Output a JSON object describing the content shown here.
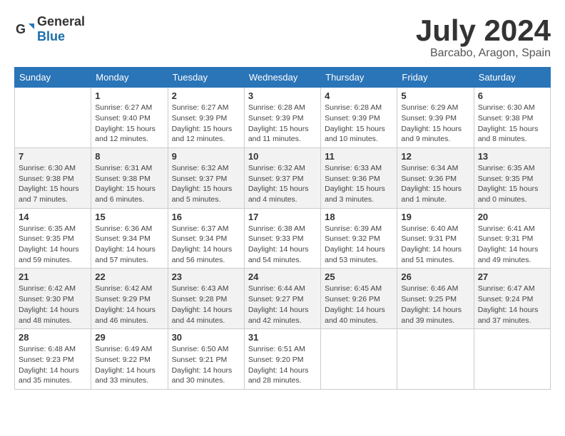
{
  "logo": {
    "text_general": "General",
    "text_blue": "Blue"
  },
  "header": {
    "title": "July 2024",
    "subtitle": "Barcabo, Aragon, Spain"
  },
  "weekdays": [
    "Sunday",
    "Monday",
    "Tuesday",
    "Wednesday",
    "Thursday",
    "Friday",
    "Saturday"
  ],
  "weeks": [
    [
      {
        "day": "",
        "info": ""
      },
      {
        "day": "1",
        "info": "Sunrise: 6:27 AM\nSunset: 9:40 PM\nDaylight: 15 hours\nand 12 minutes."
      },
      {
        "day": "2",
        "info": "Sunrise: 6:27 AM\nSunset: 9:39 PM\nDaylight: 15 hours\nand 12 minutes."
      },
      {
        "day": "3",
        "info": "Sunrise: 6:28 AM\nSunset: 9:39 PM\nDaylight: 15 hours\nand 11 minutes."
      },
      {
        "day": "4",
        "info": "Sunrise: 6:28 AM\nSunset: 9:39 PM\nDaylight: 15 hours\nand 10 minutes."
      },
      {
        "day": "5",
        "info": "Sunrise: 6:29 AM\nSunset: 9:39 PM\nDaylight: 15 hours\nand 9 minutes."
      },
      {
        "day": "6",
        "info": "Sunrise: 6:30 AM\nSunset: 9:38 PM\nDaylight: 15 hours\nand 8 minutes."
      }
    ],
    [
      {
        "day": "7",
        "info": "Sunrise: 6:30 AM\nSunset: 9:38 PM\nDaylight: 15 hours\nand 7 minutes."
      },
      {
        "day": "8",
        "info": "Sunrise: 6:31 AM\nSunset: 9:38 PM\nDaylight: 15 hours\nand 6 minutes."
      },
      {
        "day": "9",
        "info": "Sunrise: 6:32 AM\nSunset: 9:37 PM\nDaylight: 15 hours\nand 5 minutes."
      },
      {
        "day": "10",
        "info": "Sunrise: 6:32 AM\nSunset: 9:37 PM\nDaylight: 15 hours\nand 4 minutes."
      },
      {
        "day": "11",
        "info": "Sunrise: 6:33 AM\nSunset: 9:36 PM\nDaylight: 15 hours\nand 3 minutes."
      },
      {
        "day": "12",
        "info": "Sunrise: 6:34 AM\nSunset: 9:36 PM\nDaylight: 15 hours\nand 1 minute."
      },
      {
        "day": "13",
        "info": "Sunrise: 6:35 AM\nSunset: 9:35 PM\nDaylight: 15 hours\nand 0 minutes."
      }
    ],
    [
      {
        "day": "14",
        "info": "Sunrise: 6:35 AM\nSunset: 9:35 PM\nDaylight: 14 hours\nand 59 minutes."
      },
      {
        "day": "15",
        "info": "Sunrise: 6:36 AM\nSunset: 9:34 PM\nDaylight: 14 hours\nand 57 minutes."
      },
      {
        "day": "16",
        "info": "Sunrise: 6:37 AM\nSunset: 9:34 PM\nDaylight: 14 hours\nand 56 minutes."
      },
      {
        "day": "17",
        "info": "Sunrise: 6:38 AM\nSunset: 9:33 PM\nDaylight: 14 hours\nand 54 minutes."
      },
      {
        "day": "18",
        "info": "Sunrise: 6:39 AM\nSunset: 9:32 PM\nDaylight: 14 hours\nand 53 minutes."
      },
      {
        "day": "19",
        "info": "Sunrise: 6:40 AM\nSunset: 9:31 PM\nDaylight: 14 hours\nand 51 minutes."
      },
      {
        "day": "20",
        "info": "Sunrise: 6:41 AM\nSunset: 9:31 PM\nDaylight: 14 hours\nand 49 minutes."
      }
    ],
    [
      {
        "day": "21",
        "info": "Sunrise: 6:42 AM\nSunset: 9:30 PM\nDaylight: 14 hours\nand 48 minutes."
      },
      {
        "day": "22",
        "info": "Sunrise: 6:42 AM\nSunset: 9:29 PM\nDaylight: 14 hours\nand 46 minutes."
      },
      {
        "day": "23",
        "info": "Sunrise: 6:43 AM\nSunset: 9:28 PM\nDaylight: 14 hours\nand 44 minutes."
      },
      {
        "day": "24",
        "info": "Sunrise: 6:44 AM\nSunset: 9:27 PM\nDaylight: 14 hours\nand 42 minutes."
      },
      {
        "day": "25",
        "info": "Sunrise: 6:45 AM\nSunset: 9:26 PM\nDaylight: 14 hours\nand 40 minutes."
      },
      {
        "day": "26",
        "info": "Sunrise: 6:46 AM\nSunset: 9:25 PM\nDaylight: 14 hours\nand 39 minutes."
      },
      {
        "day": "27",
        "info": "Sunrise: 6:47 AM\nSunset: 9:24 PM\nDaylight: 14 hours\nand 37 minutes."
      }
    ],
    [
      {
        "day": "28",
        "info": "Sunrise: 6:48 AM\nSunset: 9:23 PM\nDaylight: 14 hours\nand 35 minutes."
      },
      {
        "day": "29",
        "info": "Sunrise: 6:49 AM\nSunset: 9:22 PM\nDaylight: 14 hours\nand 33 minutes."
      },
      {
        "day": "30",
        "info": "Sunrise: 6:50 AM\nSunset: 9:21 PM\nDaylight: 14 hours\nand 30 minutes."
      },
      {
        "day": "31",
        "info": "Sunrise: 6:51 AM\nSunset: 9:20 PM\nDaylight: 14 hours\nand 28 minutes."
      },
      {
        "day": "",
        "info": ""
      },
      {
        "day": "",
        "info": ""
      },
      {
        "day": "",
        "info": ""
      }
    ]
  ]
}
